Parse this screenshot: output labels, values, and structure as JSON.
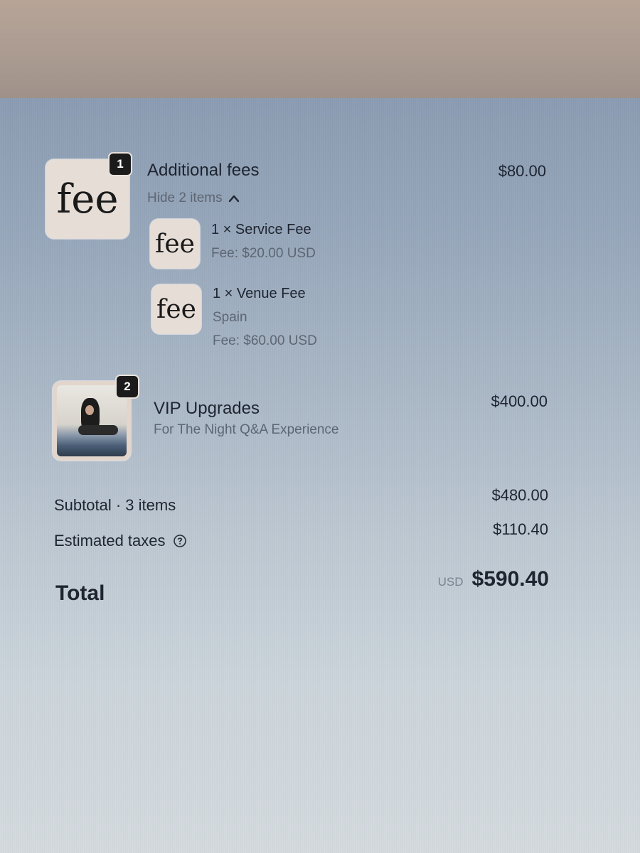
{
  "line_items": [
    {
      "badge_count": "1",
      "thumb_text": "fee",
      "title": "Additional fees",
      "price": "$80.00",
      "toggle_label": "Hide 2 items",
      "children": [
        {
          "thumb_text": "fee",
          "title": "1 × Service Fee",
          "details": [
            "Fee: $20.00 USD"
          ]
        },
        {
          "thumb_text": "fee",
          "title": "1 × Venue Fee",
          "details": [
            "Spain",
            "Fee: $60.00 USD"
          ]
        }
      ]
    },
    {
      "badge_count": "2",
      "title": "VIP Upgrades",
      "subtitle": "For The Night Q&A Experience",
      "price": "$400.00"
    }
  ],
  "summary": {
    "subtotal_label": "Subtotal · 3 items",
    "subtotal_value": "$480.00",
    "taxes_label": "Estimated taxes",
    "taxes_value": "$110.40",
    "total_label": "Total",
    "total_currency": "USD",
    "total_value": "$590.40"
  },
  "icons": {
    "toggle": "chevron-up-icon",
    "taxes_help": "question-circle-icon"
  }
}
